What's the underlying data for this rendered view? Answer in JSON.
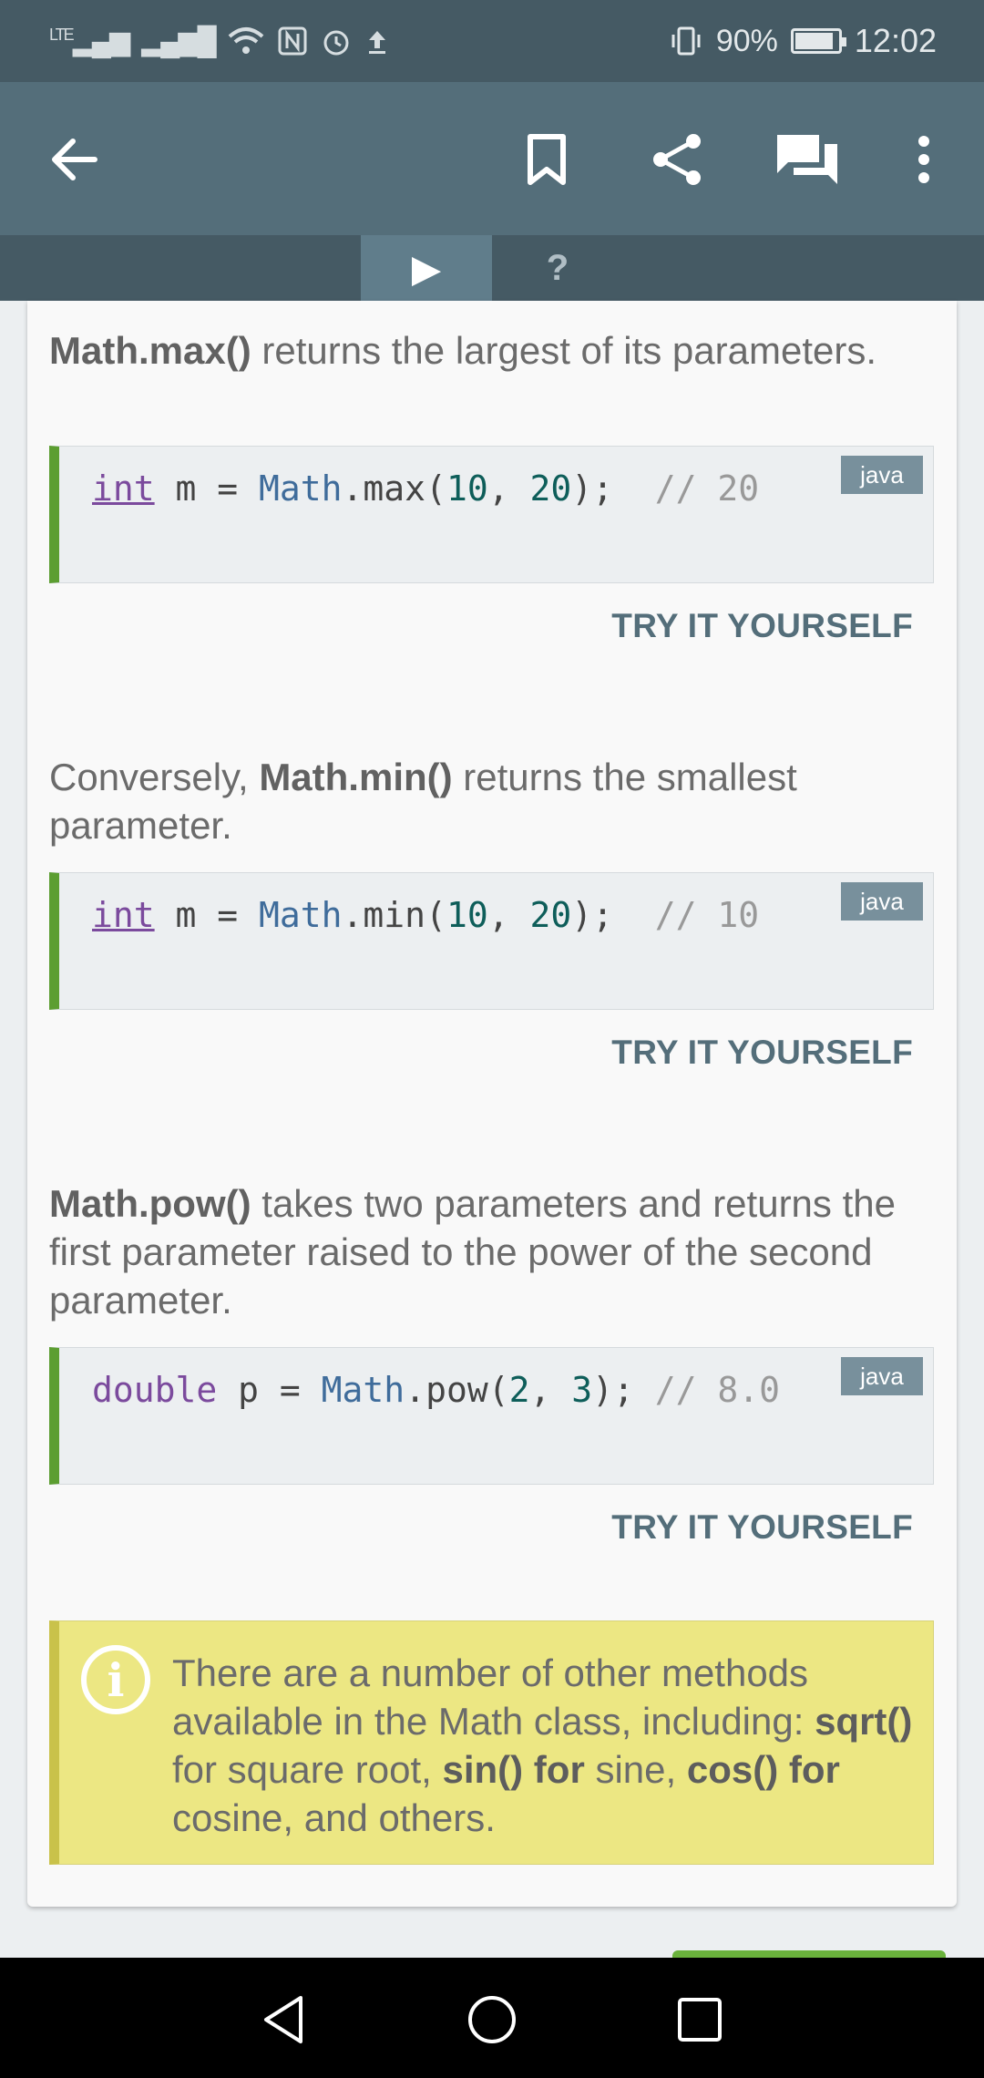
{
  "status_bar": {
    "network_label": "LTE",
    "battery": "90%",
    "battery_level": 0.9,
    "time": "12:02"
  },
  "app_bar": {
    "icons": [
      "back-arrow-icon",
      "bookmark-icon",
      "share-icon",
      "comments-icon",
      "more-vert-icon"
    ]
  },
  "tabs": [
    {
      "label": "▶",
      "active": true
    },
    {
      "label": "?",
      "active": false
    }
  ],
  "sections": [
    {
      "text_bold": "Math.max()",
      "text_rest": " returns the largest of its parameters.",
      "code": {
        "lang": "java"
      },
      "try_label": "TRY IT YOURSELF"
    },
    {
      "text_prefix": "Conversely, ",
      "text_bold": "Math.min()",
      "text_rest": " returns the smallest parameter.",
      "code": {
        "lang": "java"
      },
      "try_label": "TRY IT YOURSELF"
    },
    {
      "text_bold": "Math.pow()",
      "text_rest": " takes two parameters and returns the first parameter raised to the power of the second parameter.",
      "code": {
        "lang": "java"
      },
      "try_label": "TRY IT YOURSELF"
    }
  ],
  "code_lines": [
    {
      "t1": "int",
      "t2": " m = ",
      "t3": "Math",
      "t4": ".max(",
      "t5": "10",
      "t6": ", ",
      "t7": "20",
      "t8": ");  ",
      "t9": "// 20"
    },
    {
      "t1": "int",
      "t2": " m = ",
      "t3": "Math",
      "t4": ".min(",
      "t5": "10",
      "t6": ", ",
      "t7": "20",
      "t8": ");  ",
      "t9": "// 10"
    },
    {
      "t1": "double",
      "t2": " p = ",
      "t3": "Math",
      "t4": ".pow(",
      "t5": "2",
      "t6": ", ",
      "t7": "3",
      "t8": "); ",
      "t9": "// 8.0"
    }
  ],
  "note": {
    "line1": "There are a number of other methods available in the Math class, including: ",
    "b1": "sqrt()",
    "s1": " for square root, ",
    "b2": "sin() for",
    "s2": " sine, ",
    "b3": "cos() for",
    "s3": " cosine, and others."
  },
  "colors": {
    "app_bar": "#546e7a",
    "status_bar": "#455a64",
    "code_accent": "#5c9e31",
    "note_bg": "#ece783"
  }
}
